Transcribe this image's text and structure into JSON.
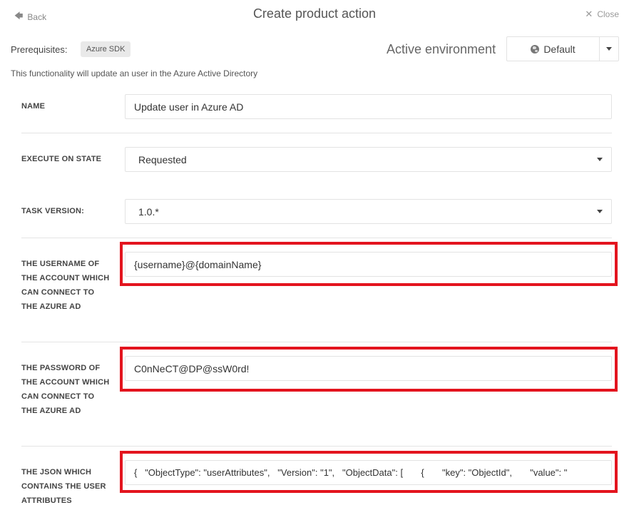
{
  "header": {
    "back_label": "Back",
    "title": "Create product action",
    "close_label": "Close"
  },
  "prerequisites": {
    "label": "Prerequisites:",
    "badge": "Azure SDK"
  },
  "environment": {
    "label": "Active environment",
    "selected": "Default"
  },
  "description": "This functionality will update an user in the Azure Active Directory",
  "form": {
    "name": {
      "label": "NAME",
      "value": "Update user in Azure AD"
    },
    "execute_on_state": {
      "label": "EXECUTE ON STATE",
      "value": "Requested"
    },
    "task_version": {
      "label": "TASK VERSION:",
      "value": "1.0.*"
    },
    "username": {
      "label": "THE USERNAME OF THE ACCOUNT WHICH CAN CONNECT TO THE AZURE AD",
      "value": "{username}@{domainName}"
    },
    "password": {
      "label": "THE PASSWORD OF THE ACCOUNT WHICH CAN CONNECT TO THE AZURE AD",
      "value": "C0nNeCT@DP@ssW0rd!"
    },
    "json": {
      "label": "THE JSON WHICH CONTAINS THE USER ATTRIBUTES",
      "value": "{   \"ObjectType\": \"userAttributes\",   \"Version\": \"1\",   \"ObjectData\": [       {       \"key\": \"ObjectId\",       \"value\": \""
    }
  },
  "colors": {
    "highlight": "#e3141e",
    "divider": "#e4e4e4"
  }
}
